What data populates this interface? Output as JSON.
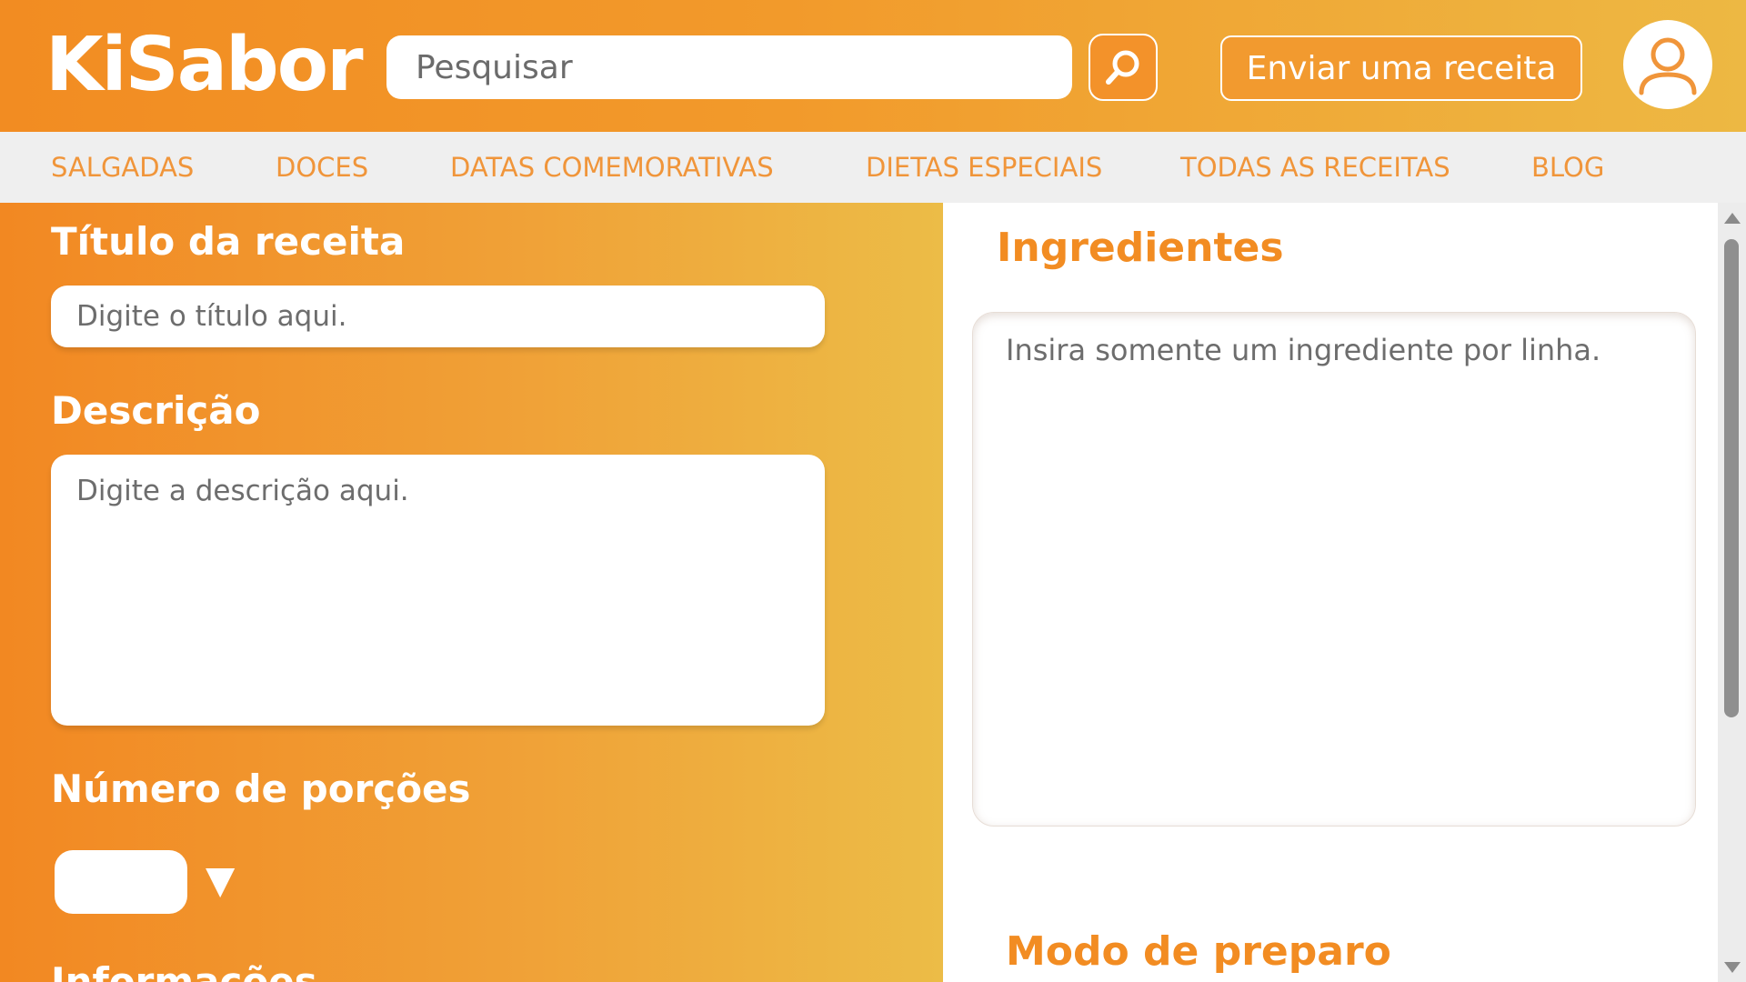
{
  "header": {
    "logo": "KiSabor",
    "search": {
      "placeholder": "Pesquisar"
    },
    "send_recipe_label": "Enviar uma receita"
  },
  "nav": {
    "items": [
      {
        "label": "SALGADAS"
      },
      {
        "label": "DOCES"
      },
      {
        "label": "DATAS COMEMORATIVAS"
      },
      {
        "label": "DIETAS ESPECIAIS"
      },
      {
        "label": "TODAS AS RECEITAS"
      },
      {
        "label": "BLOG"
      }
    ]
  },
  "form": {
    "title_label": "Título da receita",
    "title_placeholder": "Digite o título aqui.",
    "description_label": "Descrição",
    "description_placeholder": "Digite a descrição aqui.",
    "portions_label": "Número de porções",
    "portions_arrow": "▼",
    "information_label": "Informações",
    "ingredients_label": "Ingredientes",
    "ingredients_placeholder": "Insira somente um ingrediente por linha.",
    "preparation_label": "Modo de preparo"
  },
  "colors": {
    "brand_orange": "#f28c22",
    "brand_yellow": "#edb843",
    "nav_text": "#f0953a",
    "nav_background": "#efefef"
  },
  "icons": {
    "search": "magnifier-icon",
    "avatar": "user-icon",
    "dropdown": "triangle-down-icon"
  }
}
